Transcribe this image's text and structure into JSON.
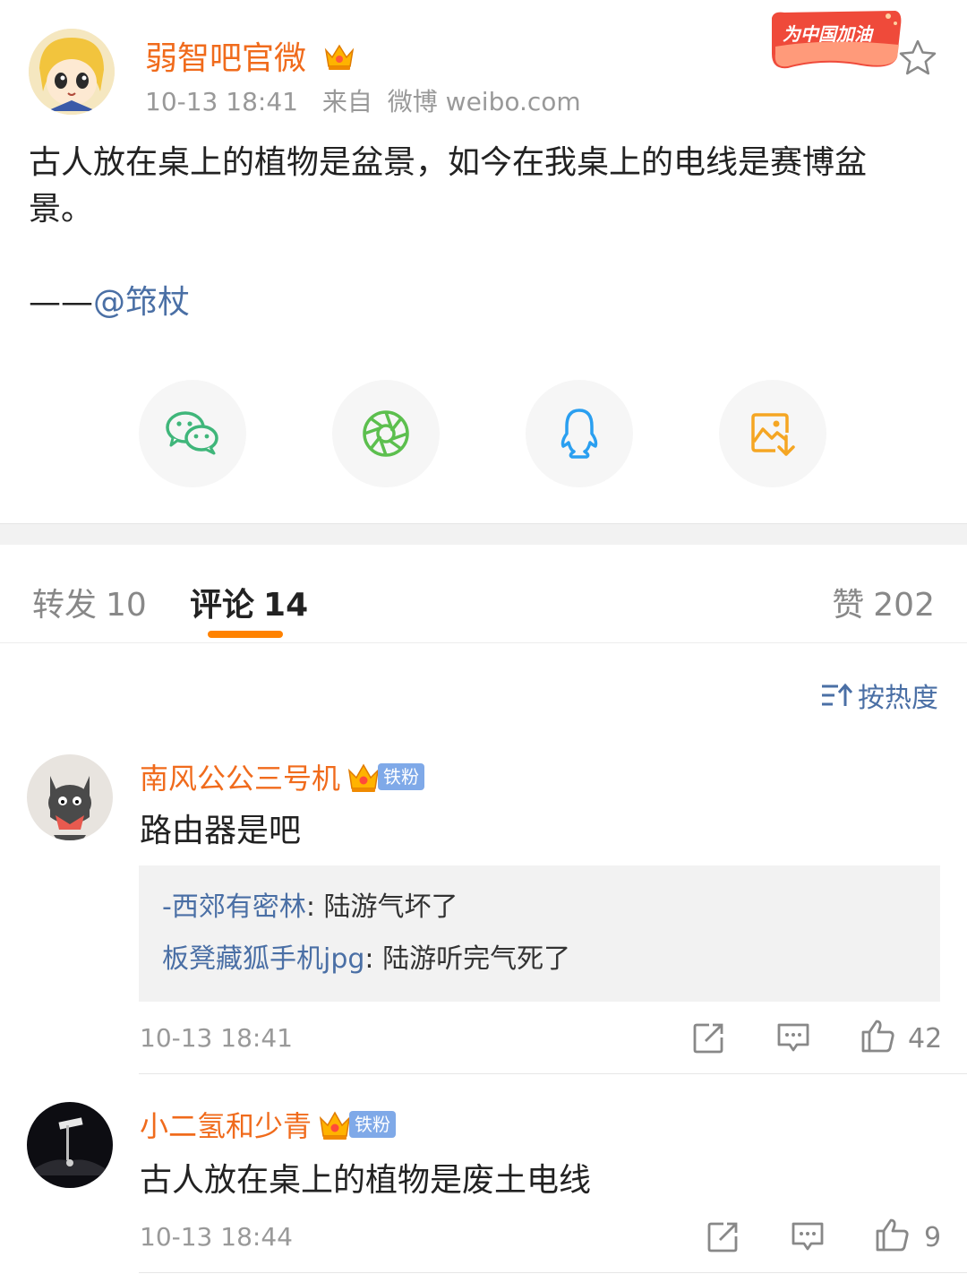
{
  "post": {
    "author": "弱智吧官微",
    "time": "10-13 18:41",
    "source_prefix": "来自",
    "source": "微博 weibo.com",
    "cheer_badge": "为中国加油",
    "text": "古人放在桌上的植物是盆景，如今在我桌上的电线是赛博盆景。",
    "signature_prefix": "——",
    "signature_mention": "@筇杖"
  },
  "share": {
    "items": [
      {
        "icon": "wechat-icon"
      },
      {
        "icon": "moments-icon"
      },
      {
        "icon": "qq-icon"
      },
      {
        "icon": "save-image-icon"
      }
    ]
  },
  "tabs": {
    "repost_label": "转发",
    "repost_count": "10",
    "comment_label": "评论",
    "comment_count": "14",
    "like_label": "赞",
    "like_count": "202"
  },
  "sort": {
    "label": "按热度"
  },
  "comments": [
    {
      "name": "南风公公三号机",
      "badge": "铁粉",
      "text": "路由器是吧",
      "replies": [
        {
          "user": "-西郊有密林",
          "text": ": 陆游气坏了"
        },
        {
          "user": "板凳藏狐手机jpg",
          "text": ": 陆游听完气死了"
        }
      ],
      "time": "10-13 18:41",
      "likes": "42"
    },
    {
      "name": "小二氢和少青",
      "badge": "铁粉",
      "text": "古人放在桌上的植物是废土电线",
      "time": "10-13 18:44",
      "likes": "9"
    }
  ],
  "colors": {
    "accent": "#ff8200",
    "name": "#f06b1c",
    "link": "#4a6fa5",
    "muted": "#999999"
  }
}
